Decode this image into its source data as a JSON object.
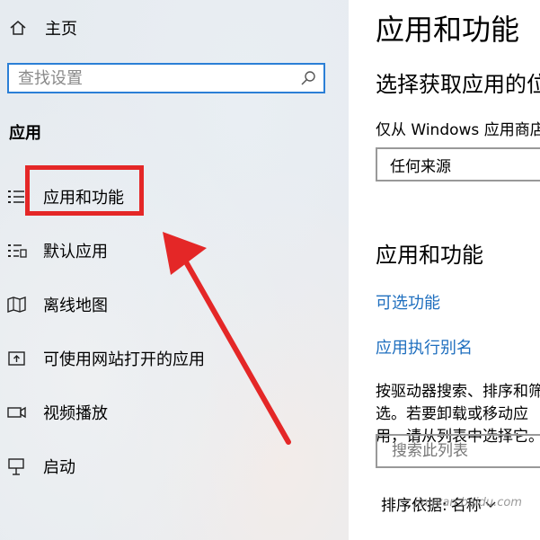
{
  "sidebar": {
    "home_label": "主页",
    "search_placeholder": "查找设置",
    "section_title": "应用",
    "items": [
      {
        "label": "应用和功能",
        "icon": "apps-features-icon"
      },
      {
        "label": "默认应用",
        "icon": "default-apps-icon"
      },
      {
        "label": "离线地图",
        "icon": "offline-maps-icon"
      },
      {
        "label": "可使用网站打开的应用",
        "icon": "apps-for-websites-icon"
      },
      {
        "label": "视频播放",
        "icon": "video-playback-icon"
      },
      {
        "label": "启动",
        "icon": "startup-icon"
      }
    ]
  },
  "main": {
    "title": "应用和功能",
    "choose_title": "选择获取应用的位",
    "from_label": "仅从 Windows 应用商店",
    "source_value": "任何来源",
    "section_title": "应用和功能",
    "optional_features_link": "可选功能",
    "app_alias_link": "应用执行别名",
    "description": "按驱动器搜索、排序和筛选。若要卸载或移动应用，请从列表中选择它。",
    "list_search_placeholder": "搜索此列表",
    "sort_label": "排序依据:",
    "sort_value": "名称"
  },
  "watermark": "jingyan.baidu.com",
  "colors": {
    "accent": "#2b7fd6",
    "link": "#1f6fbf",
    "annotation": "#e42727",
    "sidebar_bg": "#e6ebf0"
  }
}
